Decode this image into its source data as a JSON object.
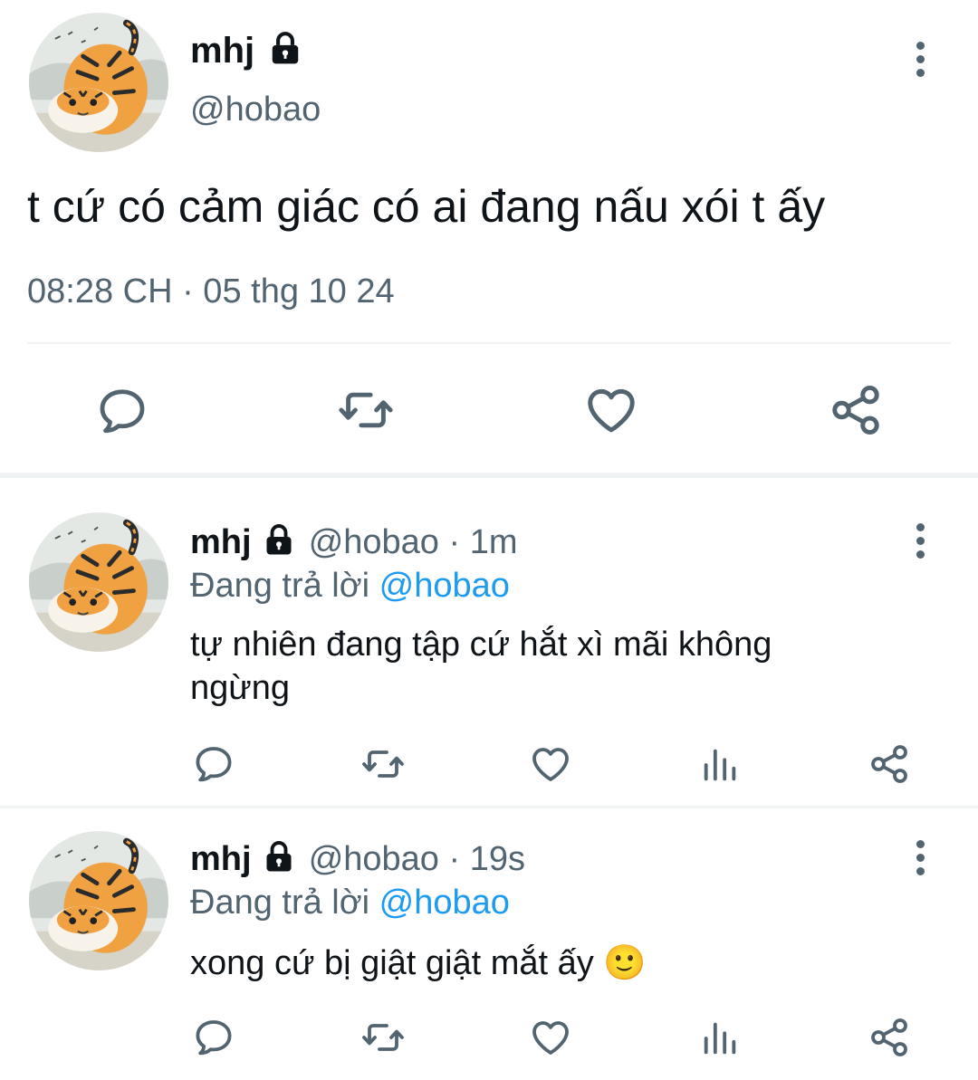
{
  "main_tweet": {
    "display_name": "mhj",
    "handle": "@hobao",
    "text": "t cứ có cảm giác có ai đang nấu xói t ấy",
    "timestamp": "08:28 CH · 05 thg 10 24"
  },
  "replies": [
    {
      "display_name": "mhj",
      "handle_time": "@hobao · 1m",
      "replying_prefix": "Đang trả lời ",
      "replying_to": "@hobao",
      "text": "tự nhiên đang tập cứ hắt xì mãi không ngừng"
    },
    {
      "display_name": "mhj",
      "handle_time": "@hobao · 19s",
      "replying_prefix": "Đang trả lời ",
      "replying_to": "@hobao",
      "text": "xong cứ bị giật giật mắt ấy 🙂"
    }
  ],
  "icons": {
    "reply": "speech-bubble-icon",
    "retweet": "retweet-icon",
    "like": "heart-icon",
    "views": "bar-chart-icon",
    "share": "share-icon",
    "lock": "lock-icon",
    "menu": "more-vertical-icon"
  },
  "colors": {
    "text": "#0f1419",
    "muted": "#536471",
    "link": "#1d9bf0",
    "divider": "#eff3f4"
  }
}
